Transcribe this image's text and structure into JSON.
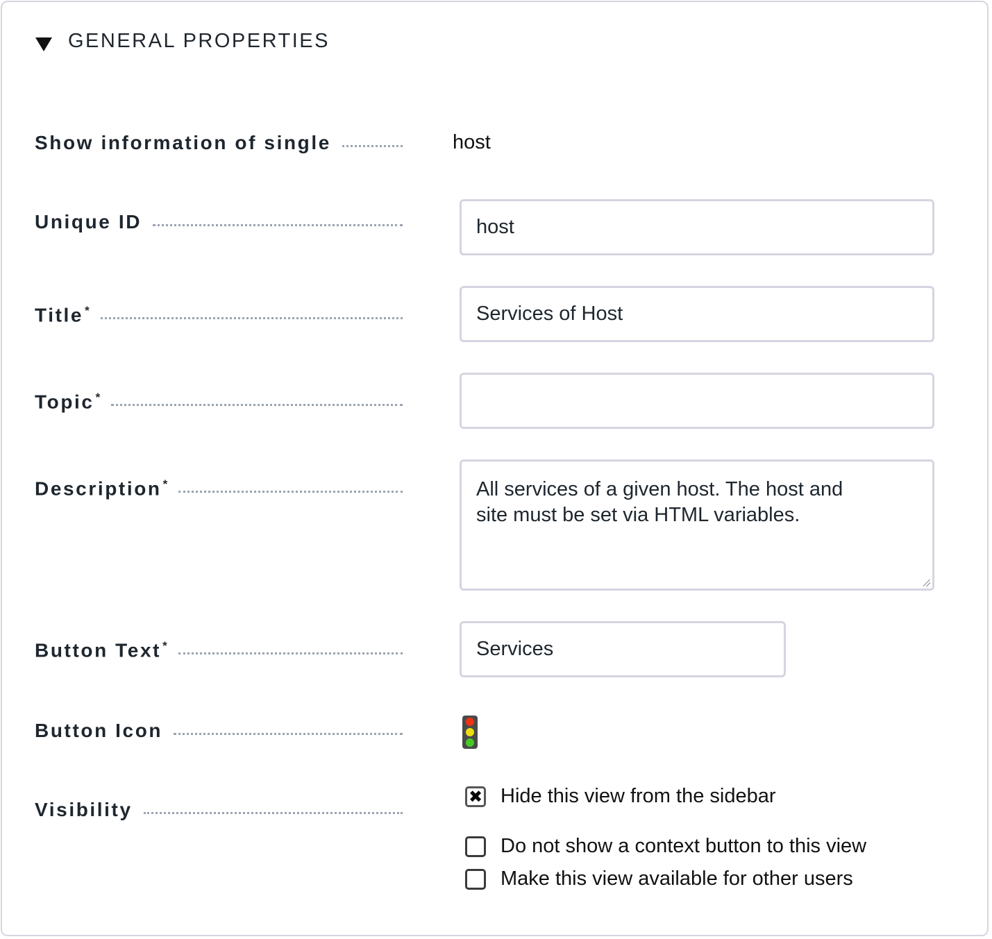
{
  "section": {
    "title": "GENERAL PROPERTIES",
    "toggle_icon": "triangle-down-icon"
  },
  "fields": {
    "single": {
      "label": "Show information of single",
      "value": "host"
    },
    "unique_id": {
      "label": "Unique ID",
      "value": "host"
    },
    "title": {
      "label": "Title",
      "required": "*",
      "value": "Services of Host"
    },
    "topic": {
      "label": "Topic",
      "required": "*",
      "value": ""
    },
    "description": {
      "label": "Description",
      "required": "*",
      "value": "All services of a given host. The host and site must be set via HTML variables."
    },
    "button_text": {
      "label": "Button Text",
      "required": "*",
      "value": "Services"
    },
    "button_icon": {
      "label": "Button Icon",
      "icon": "traffic-light-icon"
    },
    "visibility": {
      "label": "Visibility",
      "options": [
        {
          "label": "Hide this view from the sidebar",
          "checked": true
        },
        {
          "label": "Do not show a context button to this view",
          "checked": false
        },
        {
          "label": "Make this view available for other users",
          "checked": false
        }
      ]
    }
  },
  "colors": {
    "traffic_red": "#ee3311",
    "traffic_yellow": "#eedd11",
    "traffic_green": "#44cc22"
  }
}
